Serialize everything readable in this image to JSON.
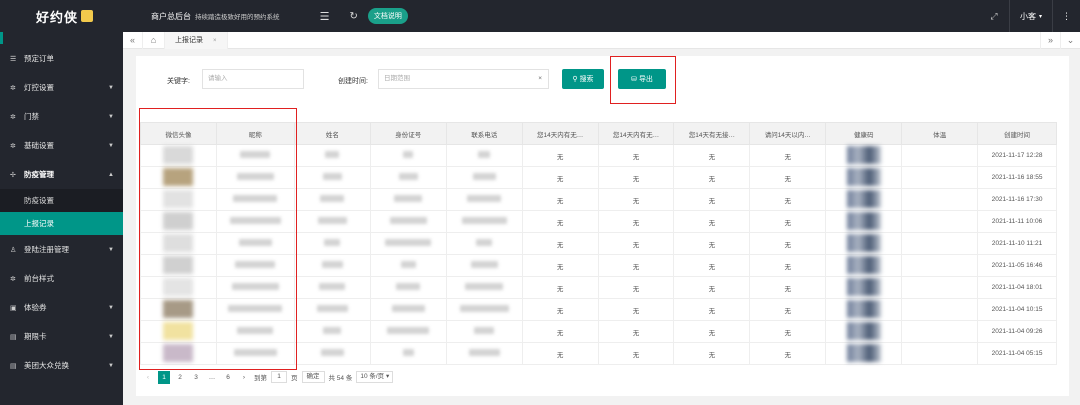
{
  "app": {
    "logo": "好约侠",
    "title": "商户总后台",
    "subtitle": "持续踏造极致好用的预约系统",
    "doc_button": "文档说明",
    "user": "小客",
    "user_caret": "▾"
  },
  "icons": {
    "menu_toggle": "☰",
    "refresh": "↻",
    "fullscreen": "⤢",
    "more": "⋮"
  },
  "sidebar": {
    "items": [
      {
        "label": "预定订单",
        "icon": "☰",
        "arrow": ""
      },
      {
        "label": "灯控设置",
        "icon": "✲",
        "arrow": "▼"
      },
      {
        "label": "门禁",
        "icon": "✲",
        "arrow": "▼"
      },
      {
        "label": "基础设置",
        "icon": "✲",
        "arrow": "▼"
      },
      {
        "label": "防疫管理",
        "icon": "✢",
        "arrow": "▲"
      }
    ],
    "sub_items": [
      {
        "label": "防疫设置"
      },
      {
        "label": "上报记录"
      }
    ],
    "items_after": [
      {
        "label": "登陆注册管理",
        "icon": "♙",
        "arrow": "▼"
      },
      {
        "label": "前台样式",
        "icon": "✲",
        "arrow": ""
      },
      {
        "label": "体验券",
        "icon": "▣",
        "arrow": "▼"
      },
      {
        "label": "期限卡",
        "icon": "▤",
        "arrow": "▼"
      },
      {
        "label": "美团大众兑换",
        "icon": "▤",
        "arrow": "▼"
      }
    ]
  },
  "tabs": {
    "left_nav": "«",
    "home": "⌂",
    "active_tab": "上报记录",
    "close": "×",
    "right_nav": "»",
    "dropdown": "⌄"
  },
  "filter": {
    "keyword_label": "关键字:",
    "keyword_placeholder": "请输入",
    "date_label": "创建时间:",
    "date_placeholder": "日期范围",
    "date_clear": "×",
    "search_button": "搜索",
    "search_icon": "⚲",
    "export_button": "导出",
    "export_icon": "⛁"
  },
  "table": {
    "columns": [
      "微信头像",
      "昵称",
      "姓名",
      "身份证号",
      "联系电话",
      "您14天内有无…",
      "您14天内有无…",
      "您14天有无接…",
      "请问14天以内…",
      "健康码",
      "体温",
      "创建时间"
    ],
    "rows": [
      {
        "q1": "无",
        "q2": "无",
        "q3": "无",
        "q4": "无",
        "created": "2021-11-17 12:28"
      },
      {
        "q1": "无",
        "q2": "无",
        "q3": "无",
        "q4": "无",
        "created": "2021-11-16 18:55"
      },
      {
        "q1": "无",
        "q2": "无",
        "q3": "无",
        "q4": "无",
        "created": "2021-11-16 17:30"
      },
      {
        "q1": "无",
        "q2": "无",
        "q3": "无",
        "q4": "无",
        "created": "2021-11-11 10:06"
      },
      {
        "q1": "无",
        "q2": "无",
        "q3": "无",
        "q4": "无",
        "created": "2021-11-10 11:21"
      },
      {
        "q1": "无",
        "q2": "无",
        "q3": "无",
        "q4": "无",
        "created": "2021-11-05 16:46"
      },
      {
        "q1": "无",
        "q2": "无",
        "q3": "无",
        "q4": "无",
        "created": "2021-11-04 18:01"
      },
      {
        "q1": "无",
        "q2": "无",
        "q3": "无",
        "q4": "无",
        "created": "2021-11-04 10:15"
      },
      {
        "q1": "无",
        "q2": "无",
        "q3": "无",
        "q4": "无",
        "created": "2021-11-04 09:26"
      },
      {
        "q1": "无",
        "q2": "无",
        "q3": "无",
        "q4": "无",
        "created": "2021-11-04 05:15"
      }
    ]
  },
  "pager": {
    "prev": "‹",
    "pages": [
      "1",
      "2",
      "3"
    ],
    "ellipsis": "…",
    "last": "6",
    "next": "›",
    "goto_label": "到第",
    "goto_value": "1",
    "page_unit": "页",
    "confirm": "确定",
    "total": "共 54 条",
    "page_size": "10 条/页 ▾"
  },
  "colors": {
    "accent": "#009688",
    "sidebar_bg": "#23262e",
    "highlight_box": "#e02020"
  }
}
